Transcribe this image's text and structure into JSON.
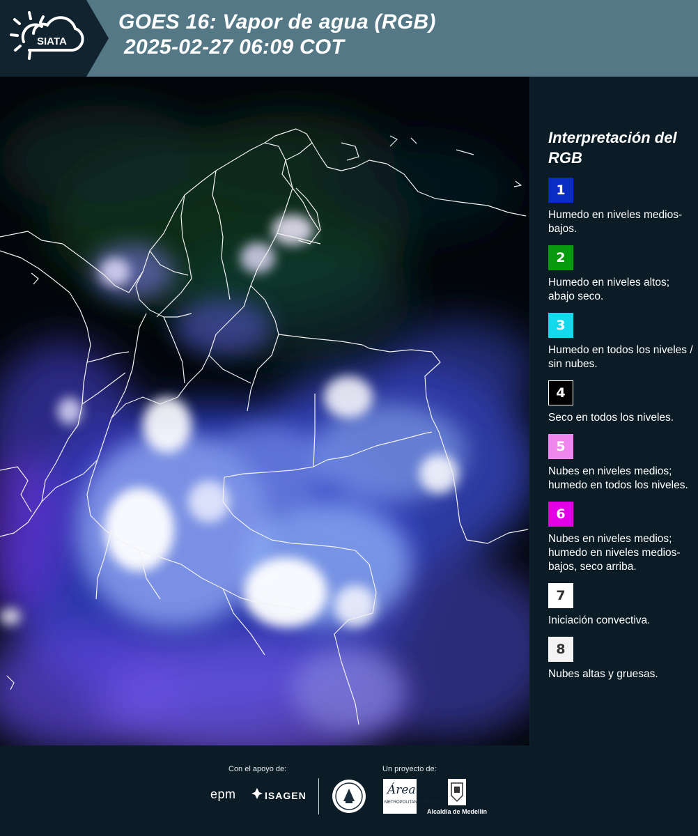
{
  "header": {
    "logo_text": "SIATA",
    "title_line1": "GOES 16: Vapor de agua (RGB)",
    "title_line2": "2025-02-27 06:09 COT"
  },
  "map": {
    "label": "",
    "background_color": "#02060a",
    "border_color": "#f2f2f2"
  },
  "legend": {
    "title": "Interpretación del RGB",
    "items": [
      {
        "number": "1",
        "color": "#0a2bc4",
        "text_color": "#ffffff",
        "description": "Humedo en niveles medios-bajos."
      },
      {
        "number": "2",
        "color": "#069a0c",
        "text_color": "#ffffff",
        "description": "Humedo en niveles altos; abajo seco."
      },
      {
        "number": "3",
        "color": "#14d8ec",
        "text_color": "#ffffff",
        "description": "Humedo en todos los niveles / sin nubes."
      },
      {
        "number": "4",
        "color": "#000000",
        "text_color": "#ffffff",
        "description": "Seco en todos los niveles."
      },
      {
        "number": "5",
        "color": "#f087ee",
        "text_color": "#ffffff",
        "description": "Nubes en niveles medios; humedo en todos los niveles."
      },
      {
        "number": "6",
        "color": "#e300e6",
        "text_color": "#ffffff",
        "description": "Nubes en niveles medios; humedo en niveles medios-bajos, seco arriba."
      },
      {
        "number": "7",
        "color": "#ffffff",
        "text_color": "#333333",
        "description": "Iniciación convectiva."
      },
      {
        "number": "8",
        "color": "#f4f4f4",
        "text_color": "#333333",
        "description": "Nubes altas y gruesas."
      }
    ]
  },
  "footer": {
    "support_label": "Con el apoyo de:",
    "project_label": "Un proyecto de:",
    "sponsor_1": "epm",
    "sponsor_2": "ISAGEN",
    "partner_area_script": "Área",
    "partner_area_sub": "METROPOLITANA Valle de Aburrá",
    "partner_alcaldia": "Alcaldía de Medellín"
  }
}
